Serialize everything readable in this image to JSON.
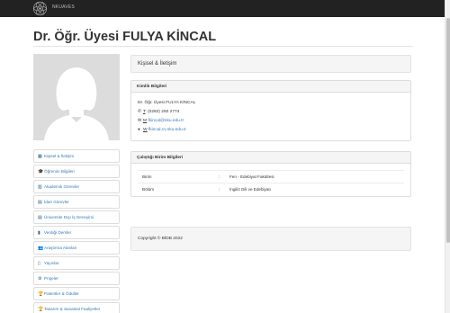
{
  "navbar": {
    "brand": "NKUAVES"
  },
  "page": {
    "title": "Dr. Öğr. Üyesi FULYA KİNCAL"
  },
  "side_menu": [
    {
      "icon": "table-icon",
      "glyph": "▦",
      "label": "Kişisel & İletişim"
    },
    {
      "icon": "graduation-cap-icon",
      "glyph": "🎓",
      "label": "Öğrenim Bilgileri"
    },
    {
      "icon": "building-icon",
      "glyph": "▥",
      "label": "Akademik Görevler"
    },
    {
      "icon": "briefcase-icon",
      "glyph": "▤",
      "label": "İdari Görevler"
    },
    {
      "icon": "briefcase-icon",
      "glyph": "▤",
      "label": "Üniversite Dışı İş Deneyimi"
    },
    {
      "icon": "book-icon",
      "glyph": "▮",
      "label": "Verdiği Dersler"
    },
    {
      "icon": "users-icon",
      "glyph": "👥",
      "label": "Araştırma Alanları"
    },
    {
      "icon": "book-open-icon",
      "glyph": "▯",
      "label": "Yayınlar"
    },
    {
      "icon": "gears-icon",
      "glyph": "⚙",
      "label": "Projeler"
    },
    {
      "icon": "trophy-icon",
      "glyph": "🏆",
      "label": "Patentler & Ödüller"
    },
    {
      "icon": "trophy-icon",
      "glyph": "🏆",
      "label": "Tasarım & Sanatsal Faaliyetler"
    }
  ],
  "main": {
    "section_title": "Kişisel & İletişim",
    "kimlik": {
      "heading": "Kimlik Bilgileri",
      "name": "Dr. Öğr. Üyesi FULYA KİNCAL",
      "phone_prefix": "T",
      "phone": ": (0282) 250 2774",
      "email_prefix": "M",
      "email": "fkincal@nku.edu.tr",
      "web_prefix": "W",
      "web": "fkincal.cv.nku.edu.tr"
    },
    "birim": {
      "heading": "Çalıştığı Birim Bilgileri",
      "rows": [
        {
          "label": "Birim",
          "sep": ":",
          "value": "Fen - Edebiyat Fakültesi"
        },
        {
          "label": "Bölüm",
          "sep": ":",
          "value": "İngiliz Dili ve Edebiyatı"
        }
      ]
    },
    "footer": "Copyright © BİDB 2022"
  },
  "colors": {
    "navbar": "#222222",
    "link": "#337ab7",
    "panel_head": "#f5f5f5"
  }
}
